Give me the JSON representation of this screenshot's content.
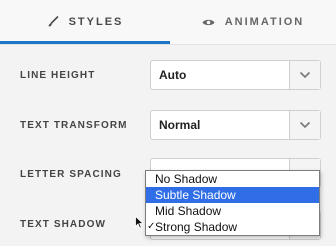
{
  "tabs": {
    "styles": {
      "label": "STYLES",
      "icon": "brush-icon"
    },
    "animation": {
      "label": "ANIMATION",
      "icon": "eye-icon"
    }
  },
  "rows": [
    {
      "label": "LINE HEIGHT",
      "value": "Auto"
    },
    {
      "label": "TEXT TRANSFORM",
      "value": "Normal"
    },
    {
      "label": "LETTER SPACING",
      "value": ""
    },
    {
      "label": "TEXT SHADOW",
      "value": ""
    }
  ],
  "text_shadow_dropdown": {
    "options": [
      "No Shadow",
      "Subtle Shadow",
      "Mid Shadow",
      "Strong Shadow"
    ],
    "highlighted": "Subtle Shadow",
    "selected": "Strong Shadow"
  },
  "colors": {
    "accent": "#1b76c7",
    "highlight": "#2f6ee6"
  }
}
